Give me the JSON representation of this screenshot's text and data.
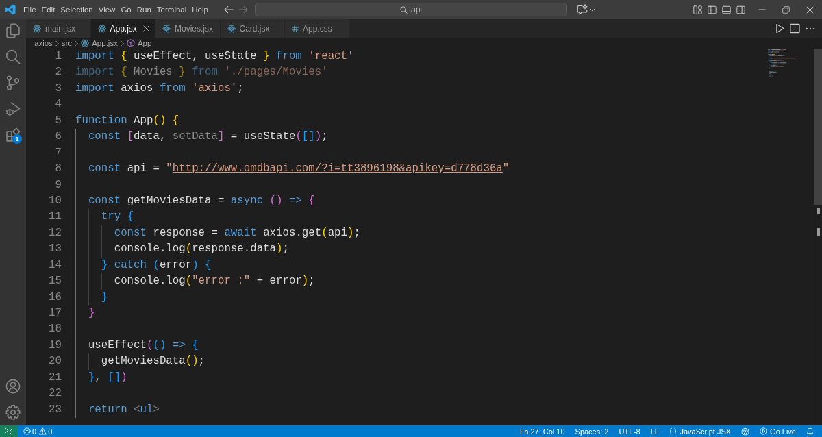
{
  "title_bar": {
    "menu": [
      {
        "label": "File"
      },
      {
        "label": "Edit"
      },
      {
        "label": "Selection"
      },
      {
        "label": "View"
      },
      {
        "label": "Go"
      },
      {
        "label": "Run"
      },
      {
        "label": "Terminal"
      },
      {
        "label": "Help"
      }
    ],
    "nav_buttons": [
      {
        "kind": "back",
        "disabled": false
      },
      {
        "kind": "forward",
        "disabled": true
      }
    ],
    "command_center": {
      "value": "api"
    }
  },
  "activity_bar": {
    "items": [
      {
        "kind": "explorer",
        "selected": false
      },
      {
        "kind": "search",
        "selected": false
      },
      {
        "kind": "source-control",
        "selected": false
      },
      {
        "kind": "run-debug",
        "selected": false
      },
      {
        "kind": "extensions",
        "selected": false,
        "badge": "1"
      }
    ],
    "bottom_items": [
      {
        "kind": "accounts"
      },
      {
        "kind": "settings"
      }
    ]
  },
  "tabs": [
    {
      "label": "main.jsx",
      "kind": "react",
      "selected": false
    },
    {
      "label": "App.jsx",
      "kind": "react",
      "selected": true
    },
    {
      "label": "Movies.jsx",
      "kind": "react",
      "selected": false
    },
    {
      "label": "Card.jsx",
      "kind": "react",
      "selected": false
    },
    {
      "label": "App.css",
      "kind": "css",
      "selected": false
    }
  ],
  "breadcrumb": [
    {
      "label": "axios",
      "kind": "folder"
    },
    {
      "label": "src",
      "kind": "folder"
    },
    {
      "label": "App.jsx",
      "kind": "react"
    },
    {
      "label": "App",
      "kind": "symbol"
    }
  ],
  "editor": {
    "lines": [
      {
        "number": "1",
        "faded": false,
        "tokens": [
          {
            "kind": "keyword",
            "text": "import "
          },
          {
            "kind": "bracket1",
            "text": "{"
          },
          {
            "kind": "plain",
            "text": " useEffect, useState "
          },
          {
            "kind": "bracket1",
            "text": "}"
          },
          {
            "kind": "keyword",
            "text": " from "
          },
          {
            "kind": "string",
            "text": "'react'"
          }
        ]
      },
      {
        "number": "2",
        "faded": true,
        "tokens": [
          {
            "kind": "keyword",
            "text": "import "
          },
          {
            "kind": "bracket1",
            "text": "{"
          },
          {
            "kind": "plain",
            "text": " Movies "
          },
          {
            "kind": "bracket1",
            "text": "}"
          },
          {
            "kind": "keyword",
            "text": " from "
          },
          {
            "kind": "string",
            "text": "'./pages/Movies'"
          }
        ]
      },
      {
        "number": "3",
        "faded": false,
        "tokens": [
          {
            "kind": "keyword",
            "text": "import "
          },
          {
            "kind": "plain",
            "text": "axios "
          },
          {
            "kind": "keyword",
            "text": "from "
          },
          {
            "kind": "string",
            "text": "'axios'"
          },
          {
            "kind": "plain",
            "text": ";"
          }
        ]
      },
      {
        "number": "4"
      },
      {
        "number": "5",
        "faded": false,
        "tokens": [
          {
            "kind": "keyword",
            "text": "function "
          },
          {
            "kind": "plain",
            "text": "App"
          },
          {
            "kind": "bracket1",
            "text": "() {"
          }
        ]
      },
      {
        "number": "6",
        "faded": false,
        "tokens": [
          {
            "kind": "keyword",
            "text": "  const "
          },
          {
            "kind": "bracket2",
            "text": "["
          },
          {
            "kind": "plain",
            "text": "data, "
          },
          {
            "kind": "unused",
            "text": "setData"
          },
          {
            "kind": "bracket2",
            "text": "]"
          },
          {
            "kind": "plain",
            "text": " = useState"
          },
          {
            "kind": "bracket2",
            "text": "("
          },
          {
            "kind": "bracket3",
            "text": "[]"
          },
          {
            "kind": "bracket2",
            "text": ")"
          },
          {
            "kind": "plain",
            "text": ";"
          }
        ]
      },
      {
        "number": "7"
      },
      {
        "number": "8",
        "faded": false,
        "tokens": [
          {
            "kind": "keyword",
            "text": "  const "
          },
          {
            "kind": "plain",
            "text": "api = "
          },
          {
            "kind": "string",
            "text": "\""
          },
          {
            "kind": "link",
            "text": "http://www.omdbapi.com/?i=tt3896198&apikey=d778d36a"
          },
          {
            "kind": "string",
            "text": "\""
          }
        ]
      },
      {
        "number": "9"
      },
      {
        "number": "10",
        "faded": false,
        "tokens": [
          {
            "kind": "keyword",
            "text": "  const "
          },
          {
            "kind": "plain",
            "text": "getMoviesData = "
          },
          {
            "kind": "keyword",
            "text": "async "
          },
          {
            "kind": "bracket2",
            "text": "() "
          },
          {
            "kind": "keyword",
            "text": "=> "
          },
          {
            "kind": "bracket2",
            "text": "{"
          }
        ]
      },
      {
        "number": "11",
        "faded": false,
        "tokens": [
          {
            "kind": "keyword",
            "text": "    try "
          },
          {
            "kind": "bracket3",
            "text": "{"
          }
        ]
      },
      {
        "number": "12",
        "faded": false,
        "tokens": [
          {
            "kind": "keyword",
            "text": "      const "
          },
          {
            "kind": "plain",
            "text": "response = "
          },
          {
            "kind": "keyword",
            "text": "await "
          },
          {
            "kind": "plain",
            "text": "axios.get"
          },
          {
            "kind": "bracket1",
            "text": "("
          },
          {
            "kind": "plain",
            "text": "api"
          },
          {
            "kind": "bracket1",
            "text": ")"
          },
          {
            "kind": "plain",
            "text": ";"
          }
        ]
      },
      {
        "number": "13",
        "faded": false,
        "tokens": [
          {
            "kind": "plain",
            "text": "      console.log"
          },
          {
            "kind": "bracket1",
            "text": "("
          },
          {
            "kind": "plain",
            "text": "response.data"
          },
          {
            "kind": "bracket1",
            "text": ")"
          },
          {
            "kind": "plain",
            "text": ";"
          }
        ]
      },
      {
        "number": "14",
        "faded": false,
        "tokens": [
          {
            "kind": "bracket3",
            "text": "    } "
          },
          {
            "kind": "keyword",
            "text": "catch "
          },
          {
            "kind": "bracket3",
            "text": "("
          },
          {
            "kind": "plain",
            "text": "error"
          },
          {
            "kind": "bracket3",
            "text": ") {"
          }
        ]
      },
      {
        "number": "15",
        "faded": false,
        "tokens": [
          {
            "kind": "plain",
            "text": "      console.log"
          },
          {
            "kind": "bracket1",
            "text": "("
          },
          {
            "kind": "string",
            "text": "\"error :\""
          },
          {
            "kind": "plain",
            "text": " + error"
          },
          {
            "kind": "bracket1",
            "text": ")"
          },
          {
            "kind": "plain",
            "text": ";"
          }
        ]
      },
      {
        "number": "16",
        "faded": false,
        "tokens": [
          {
            "kind": "bracket3",
            "text": "    }"
          }
        ]
      },
      {
        "number": "17",
        "faded": false,
        "tokens": [
          {
            "kind": "bracket2",
            "text": "  }"
          }
        ]
      },
      {
        "number": "18"
      },
      {
        "number": "19",
        "faded": false,
        "tokens": [
          {
            "kind": "plain",
            "text": "  useEffect"
          },
          {
            "kind": "bracket2",
            "text": "("
          },
          {
            "kind": "bracket3",
            "text": "() "
          },
          {
            "kind": "keyword",
            "text": "=> "
          },
          {
            "kind": "bracket3",
            "text": "{"
          }
        ]
      },
      {
        "number": "20",
        "faded": false,
        "tokens": [
          {
            "kind": "plain",
            "text": "    getMoviesData"
          },
          {
            "kind": "bracket1",
            "text": "()"
          },
          {
            "kind": "plain",
            "text": ";"
          }
        ]
      },
      {
        "number": "21",
        "faded": false,
        "tokens": [
          {
            "kind": "bracket3",
            "text": "  }"
          },
          {
            "kind": "plain",
            "text": ", "
          },
          {
            "kind": "bracket3",
            "text": "[]"
          },
          {
            "kind": "bracket2",
            "text": ")"
          }
        ]
      },
      {
        "number": "22"
      },
      {
        "number": "23",
        "faded": false,
        "tokens": [
          {
            "kind": "keyword",
            "text": "  return "
          },
          {
            "kind": "tagbracket",
            "text": "<"
          },
          {
            "kind": "tag",
            "text": "ul"
          },
          {
            "kind": "tagbracket",
            "text": ">"
          }
        ]
      }
    ]
  },
  "status_bar": {
    "errors": "0",
    "warnings": "0",
    "items": [
      {
        "kind": "text",
        "label": "Ln 27, Col 10"
      },
      {
        "kind": "text",
        "label": "Spaces: 2"
      },
      {
        "kind": "text",
        "label": "UTF-8"
      },
      {
        "kind": "text",
        "label": "LF"
      },
      {
        "kind": "language",
        "label": "JavaScript JSX"
      },
      {
        "kind": "copilot"
      },
      {
        "kind": "golive",
        "label": "Go Live"
      },
      {
        "kind": "bell"
      }
    ]
  }
}
